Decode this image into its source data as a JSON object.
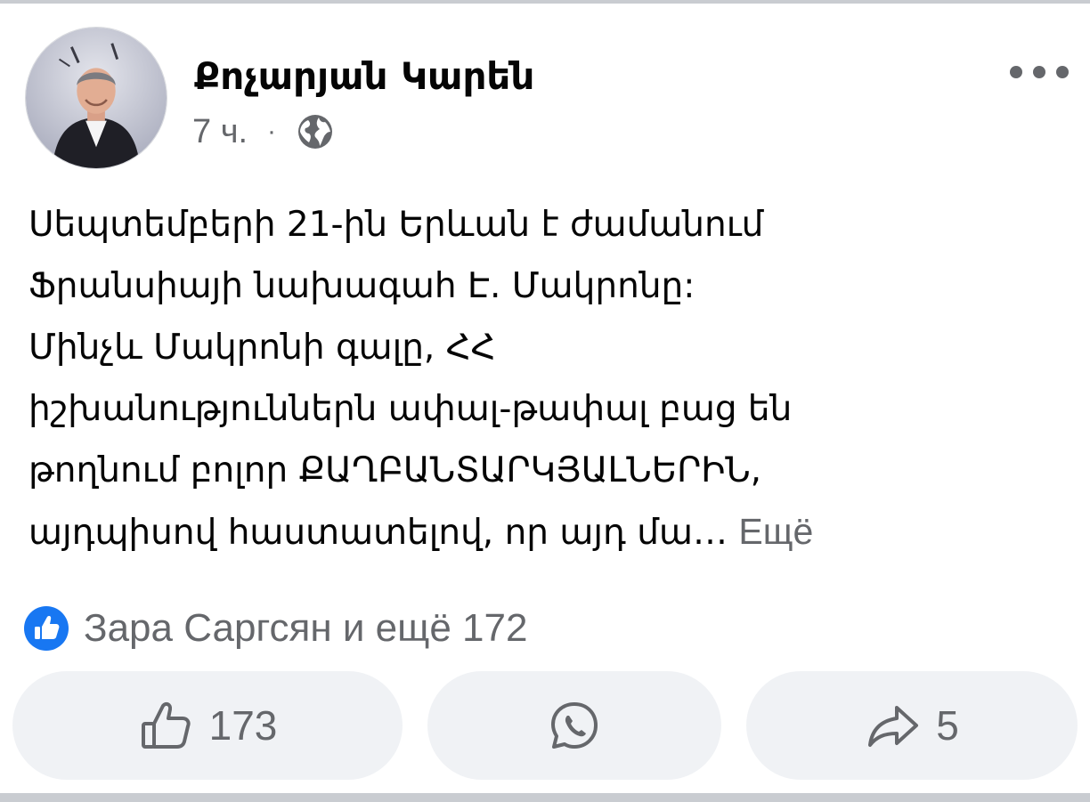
{
  "post": {
    "author": "Քոչարյան Կարեն",
    "time": "7 ч.",
    "separator": "·",
    "privacy_icon": "globe-icon",
    "more_icon": "more-dots-icon",
    "text_lines": [
      "Սեպտեմբերի 21-ին Երևան է ժամանում",
      "Ֆրանսիայի նախագահ Է. Մակրոնը:",
      "Մինչև Մակրոնի գալը, ՀՀ",
      "իշխանություններն ափալ-թափալ բաց են",
      "թողնում բոլոր ՔԱՂԲԱՆՏԱՐԿՅԱԼՆԵՐԻՆ,",
      "այդպիսով հաստատելով, որ այդ մա…"
    ],
    "see_more": "Ещё"
  },
  "reactions": {
    "icon": "like-badge-icon",
    "summary": "Зара Саргсян и ещё 172"
  },
  "actions": {
    "like": {
      "icon": "thumbs-up-icon",
      "count": "173"
    },
    "message": {
      "icon": "whatsapp-icon"
    },
    "share": {
      "icon": "share-arrow-icon",
      "count": "5"
    }
  },
  "colors": {
    "text": "#050505",
    "secondary": "#65676b",
    "pill_bg": "#f0f2f5",
    "like_blue": "#1877f2",
    "divider": "#c9ccd1"
  }
}
